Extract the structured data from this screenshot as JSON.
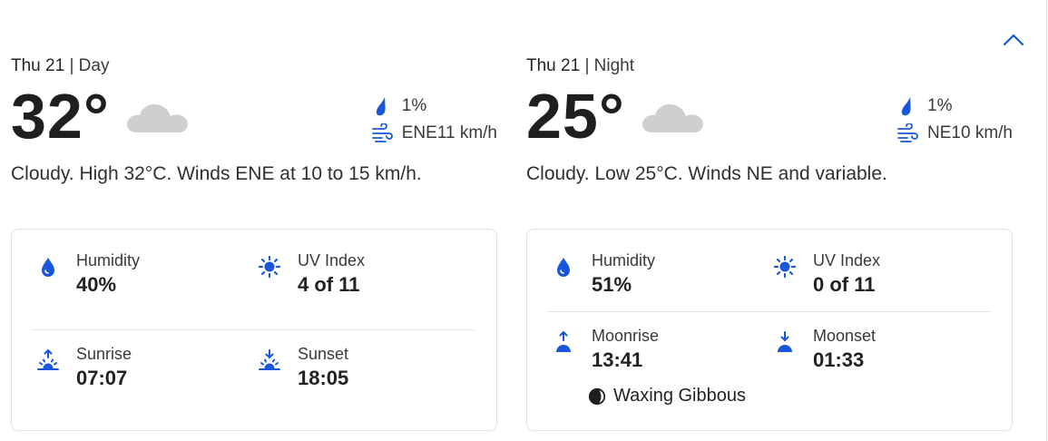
{
  "colors": {
    "accent": "#1a56db",
    "text": "#252525",
    "cloud": "#cfcfcf",
    "border": "#e1e1e1"
  },
  "day": {
    "date": "Thu 21",
    "separator": "|",
    "part": "Day",
    "temperature": "32°",
    "condition_icon": "cloud-icon",
    "precip": "1%",
    "wind": "ENE11 km/h",
    "summary": "Cloudy. High 32°C. Winds ENE at 10 to 15 km/h.",
    "details": {
      "humidity_label": "Humidity",
      "humidity_value": "40%",
      "uv_label": "UV Index",
      "uv_value": "4 of 11",
      "sunrise_label": "Sunrise",
      "sunrise_value": "07:07",
      "sunset_label": "Sunset",
      "sunset_value": "18:05"
    }
  },
  "night": {
    "date": "Thu 21",
    "separator": "|",
    "part": "Night",
    "temperature": "25°",
    "condition_icon": "cloud-icon",
    "precip": "1%",
    "wind": "NE10 km/h",
    "summary": "Cloudy. Low 25°C. Winds NE and variable.",
    "details": {
      "humidity_label": "Humidity",
      "humidity_value": "51%",
      "uv_label": "UV Index",
      "uv_value": "0 of 11",
      "moonrise_label": "Moonrise",
      "moonrise_value": "13:41",
      "moonset_label": "Moonset",
      "moonset_value": "01:33",
      "moon_phase": "Waxing Gibbous"
    }
  }
}
